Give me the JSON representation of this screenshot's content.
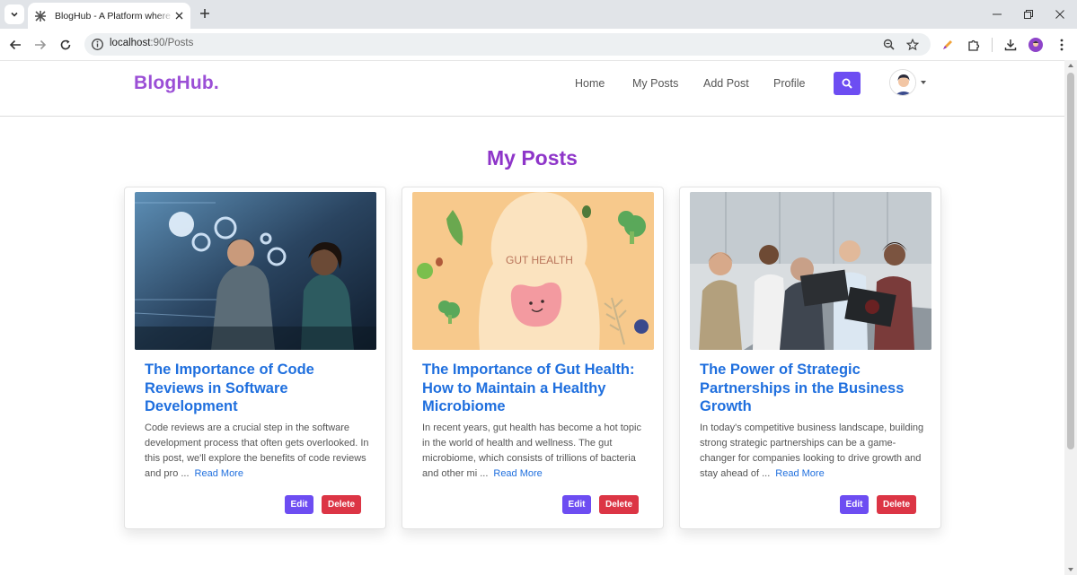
{
  "browser": {
    "tab_title": "BlogHub - A Platform where your thoughts take flight",
    "url_host": "localhost",
    "url_rest": ":90/Posts"
  },
  "navbar": {
    "brand": "BlogHub.",
    "links": [
      "Home",
      "My Posts",
      "Add Post",
      "Profile"
    ]
  },
  "page": {
    "title": "My Posts"
  },
  "posts": [
    {
      "title": "The Importance of Code Reviews in Software Development",
      "excerpt": "Code reviews are a crucial step in the software development process that often gets overlooked. In this post, we'll explore the benefits of code reviews and pro ...",
      "read_more": "Read More",
      "edit": "Edit",
      "delete": "Delete"
    },
    {
      "title": "The Importance of Gut Health: How to Maintain a Healthy Microbiome",
      "excerpt": "In recent years, gut health has become a hot topic in the world of health and wellness. The gut microbiome, which consists of trillions of bacteria and other mi ...",
      "read_more": "Read More",
      "edit": "Edit",
      "delete": "Delete",
      "image_text": "GUT HEALTH"
    },
    {
      "title": "The Power of Strategic Partnerships in the Business Growth",
      "excerpt": "In today's competitive business landscape, building strong strategic partnerships can be a game-changer for companies looking to drive growth and stay ahead of ...",
      "read_more": "Read More",
      "edit": "Edit",
      "delete": "Delete"
    }
  ],
  "colors": {
    "brand": "#9b4fd6",
    "title": "#8e35c9",
    "link": "#1f6fde",
    "primary": "#6d4df2",
    "danger": "#dc3545"
  }
}
